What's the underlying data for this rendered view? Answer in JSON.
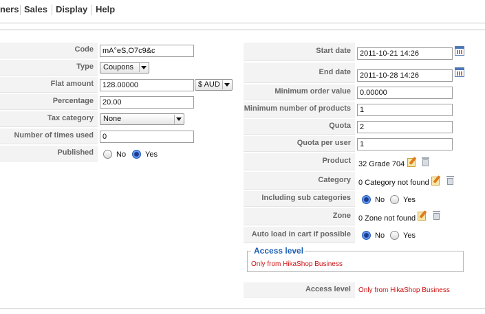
{
  "menu": {
    "items": [
      "ners",
      "Sales",
      "Display",
      "Help"
    ]
  },
  "left": {
    "code_label": "Code",
    "code_value": "mA°eS,O7c9&c",
    "type_label": "Type",
    "type_value": "Coupons",
    "flat_label": "Flat amount",
    "flat_value": "128.00000",
    "currency_value": "$ AUD",
    "percentage_label": "Percentage",
    "percentage_value": "20.00",
    "tax_label": "Tax category",
    "tax_value": "None",
    "times_label": "Number of times used",
    "times_value": "0",
    "published_label": "Published",
    "no_label": "No",
    "yes_label": "Yes"
  },
  "right": {
    "start_label": "Start date",
    "start_value": "2011-10-21 14:26",
    "end_label": "End date",
    "end_value": "2011-10-28 14:26",
    "minorder_label": "Minimum order value",
    "minorder_value": "0.00000",
    "minprod_label": "Minimum number of products",
    "minprod_value": "1",
    "quota_label": "Quota",
    "quota_value": "2",
    "quotauser_label": "Quota per user",
    "quotauser_value": "1",
    "product_label": "Product",
    "product_value": "32 Grade 704",
    "category_label": "Category",
    "category_value": "0 Category not found",
    "subcat_label": "Including sub categories",
    "subcat_no": "No",
    "subcat_yes": "Yes",
    "zone_label": "Zone",
    "zone_value": "0 Zone not found",
    "autoload_label": "Auto load in cart if possible",
    "autoload_no": "No",
    "autoload_yes": "Yes",
    "access_legend": "Access level",
    "access_fieldset_text": "Only from HikaShop Business",
    "access_label": "Access level",
    "access_value": "Only from HikaShop Business"
  }
}
